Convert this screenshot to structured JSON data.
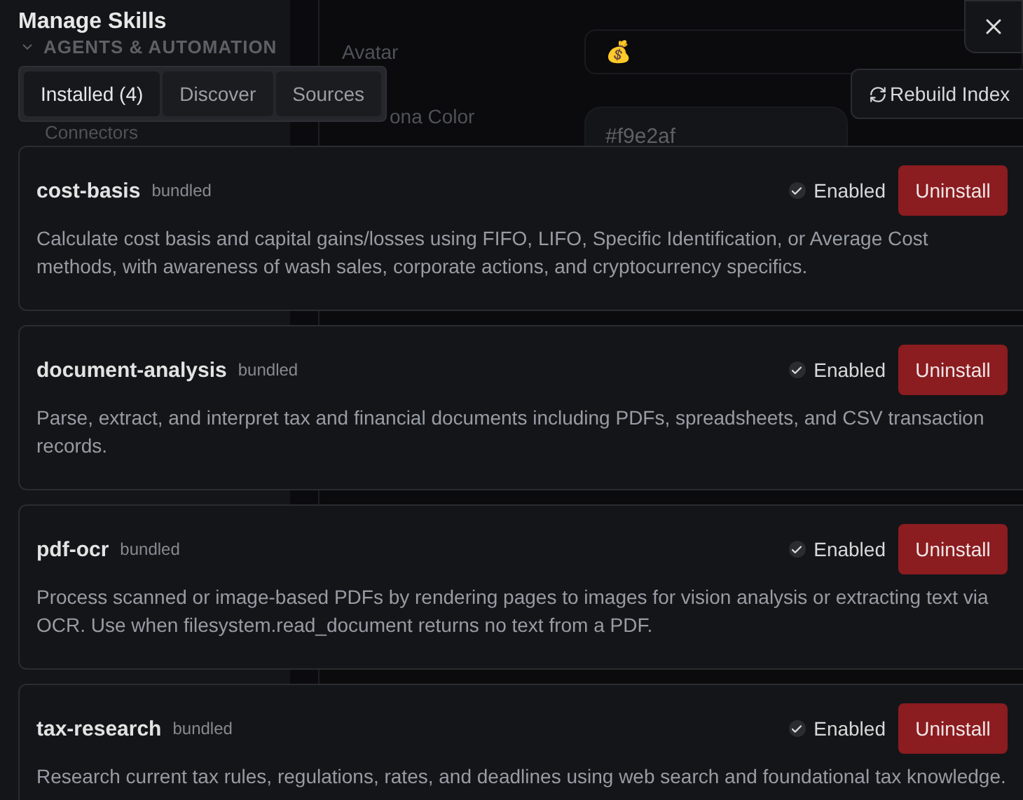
{
  "background": {
    "sidebar": {
      "sections": [
        {
          "label": "AGENTS & AUTOMATION",
          "expanded": true
        }
      ],
      "items": [
        "Connectors"
      ]
    },
    "fields": [
      {
        "label": "Avatar",
        "value": "💰"
      },
      {
        "label": "ona Color",
        "value": "#f9e2af"
      }
    ]
  },
  "modal": {
    "title": "Manage Skills",
    "tabs": [
      {
        "label": "Installed (4)",
        "selected": true
      },
      {
        "label": "Discover",
        "selected": false
      },
      {
        "label": "Sources",
        "selected": false
      }
    ],
    "rebuild_button": "Rebuild Index",
    "skills": [
      {
        "name": "cost-basis",
        "source": "bundled",
        "enabled": true,
        "enabled_label": "Enabled",
        "action": "Uninstall",
        "description": "Calculate cost basis and capital gains/losses using FIFO, LIFO, Specific Identification, or Average Cost methods, with awareness of wash sales, corporate actions, and cryptocurrency specifics."
      },
      {
        "name": "document-analysis",
        "source": "bundled",
        "enabled": true,
        "enabled_label": "Enabled",
        "action": "Uninstall",
        "description": "Parse, extract, and interpret tax and financial documents including PDFs, spreadsheets, and CSV transaction records."
      },
      {
        "name": "pdf-ocr",
        "source": "bundled",
        "enabled": true,
        "enabled_label": "Enabled",
        "action": "Uninstall",
        "description": "Process scanned or image-based PDFs by rendering pages to images for vision analysis or extracting text via OCR. Use when filesystem.read_document returns no text from a PDF."
      },
      {
        "name": "tax-research",
        "source": "bundled",
        "enabled": true,
        "enabled_label": "Enabled",
        "action": "Uninstall",
        "description": "Research current tax rules, regulations, rates, and deadlines using web search and foundational tax knowledge."
      }
    ]
  }
}
